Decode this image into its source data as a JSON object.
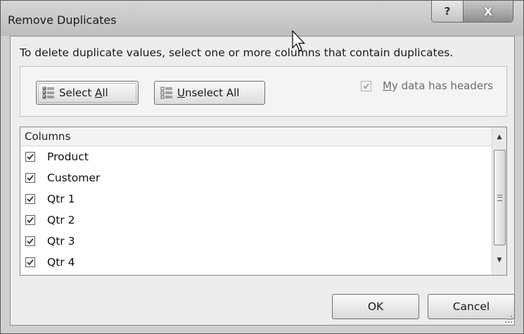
{
  "window": {
    "title": "Remove Duplicates",
    "help_glyph": "?",
    "close_glyph": "X"
  },
  "instruction": "To delete duplicate values, select one or more columns that contain duplicates.",
  "buttons": {
    "select_all": {
      "pre": "Select ",
      "mnemonic": "A",
      "post": "ll",
      "icon": "select-all-icon"
    },
    "unselect_all": {
      "pre": "",
      "mnemonic": "U",
      "post": "nselect All",
      "icon": "unselect-all-icon"
    }
  },
  "headers_option": {
    "mnemonic": "M",
    "rest": "y data has headers",
    "checked": true,
    "enabled": false
  },
  "columns_list": {
    "header": "Columns",
    "items": [
      {
        "label": "Product",
        "checked": true
      },
      {
        "label": "Customer",
        "checked": true
      },
      {
        "label": "Qtr 1",
        "checked": true
      },
      {
        "label": "Qtr 2",
        "checked": true
      },
      {
        "label": "Qtr 3",
        "checked": true
      },
      {
        "label": "Qtr 4",
        "checked": true
      }
    ]
  },
  "footer": {
    "ok_label": "OK",
    "cancel_label": "Cancel"
  }
}
